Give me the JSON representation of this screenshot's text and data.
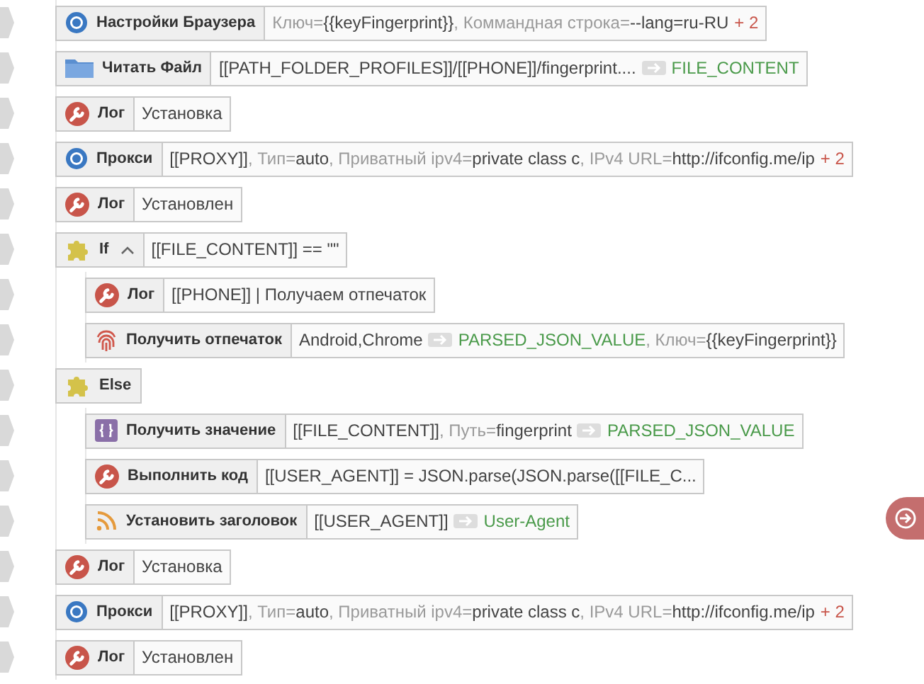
{
  "blocks": [
    {
      "kind": "browser",
      "title": "Настройки Браузера",
      "params": [
        {
          "kind": "key",
          "text": "Ключ="
        },
        {
          "kind": "value",
          "text": "{{keyFingerprint}}"
        },
        {
          "kind": "key",
          "text": ", Коммандная строка="
        },
        {
          "kind": "value",
          "text": "--lang=ru-RU"
        },
        {
          "kind": "more",
          "text": "+ 2"
        }
      ]
    },
    {
      "kind": "file",
      "title": "Читать Файл",
      "params": [
        {
          "kind": "value",
          "text": "[[PATH_FOLDER_PROFILES]]/[[PHONE]]/fingerprint...."
        },
        {
          "kind": "output",
          "text": "FILE_CONTENT"
        }
      ]
    },
    {
      "kind": "log",
      "title": "Лог",
      "params": [
        {
          "kind": "value",
          "text": "Установка"
        }
      ]
    },
    {
      "kind": "browser",
      "title": "Прокси",
      "params": [
        {
          "kind": "value",
          "text": "[[PROXY]]"
        },
        {
          "kind": "key",
          "text": ", Тип="
        },
        {
          "kind": "value",
          "text": "auto"
        },
        {
          "kind": "key",
          "text": ", Приватный ipv4="
        },
        {
          "kind": "value",
          "text": "private class c"
        },
        {
          "kind": "key",
          "text": ", IPv4 URL="
        },
        {
          "kind": "value",
          "text": "http://ifconfig.me/ip"
        },
        {
          "kind": "more",
          "text": "+ 2"
        }
      ]
    },
    {
      "kind": "log",
      "title": "Лог",
      "params": [
        {
          "kind": "value",
          "text": "Установлен"
        }
      ]
    },
    {
      "kind": "condition",
      "title": "If",
      "expanded": true,
      "params": [
        {
          "kind": "value",
          "text": "[[FILE_CONTENT]] == \"\""
        }
      ],
      "children": [
        {
          "kind": "log",
          "title": "Лог",
          "params": [
            {
              "kind": "value",
              "text": "[[PHONE]] | Получаем отпечаток"
            }
          ]
        },
        {
          "kind": "fingerprint",
          "title": "Получить отпечаток",
          "params": [
            {
              "kind": "value",
              "text": "Android,Chrome"
            },
            {
              "kind": "output",
              "text": "PARSED_JSON_VALUE"
            },
            {
              "kind": "key",
              "text": ", Ключ="
            },
            {
              "kind": "value",
              "text": "{{keyFingerprint}}"
            }
          ]
        }
      ]
    },
    {
      "kind": "condition",
      "title": "Else",
      "children": [
        {
          "kind": "json",
          "title": "Получить значение",
          "params": [
            {
              "kind": "value",
              "text": "[[FILE_CONTENT]]"
            },
            {
              "kind": "key",
              "text": ", Путь="
            },
            {
              "kind": "value",
              "text": "fingerprint"
            },
            {
              "kind": "output",
              "text": "PARSED_JSON_VALUE"
            }
          ]
        },
        {
          "kind": "log",
          "title": "Выполнить код",
          "params": [
            {
              "kind": "value",
              "text": "[[USER_AGENT]] = JSON.parse(JSON.parse([[FILE_C..."
            }
          ]
        },
        {
          "kind": "header",
          "title": "Установить заголовок",
          "params": [
            {
              "kind": "value",
              "text": "[[USER_AGENT]]"
            },
            {
              "kind": "output",
              "text": "User-Agent"
            }
          ]
        }
      ]
    },
    {
      "kind": "log",
      "title": "Лог",
      "params": [
        {
          "kind": "value",
          "text": "Установка"
        }
      ]
    },
    {
      "kind": "browser",
      "title": "Прокси",
      "params": [
        {
          "kind": "value",
          "text": "[[PROXY]]"
        },
        {
          "kind": "key",
          "text": ", Тип="
        },
        {
          "kind": "value",
          "text": "auto"
        },
        {
          "kind": "key",
          "text": ", Приватный ipv4="
        },
        {
          "kind": "value",
          "text": "private class c"
        },
        {
          "kind": "key",
          "text": ", IPv4 URL="
        },
        {
          "kind": "value",
          "text": "http://ifconfig.me/ip"
        },
        {
          "kind": "more",
          "text": "+ 2"
        }
      ]
    },
    {
      "kind": "log",
      "title": "Лог",
      "params": [
        {
          "kind": "value",
          "text": "Установлен"
        }
      ]
    }
  ]
}
